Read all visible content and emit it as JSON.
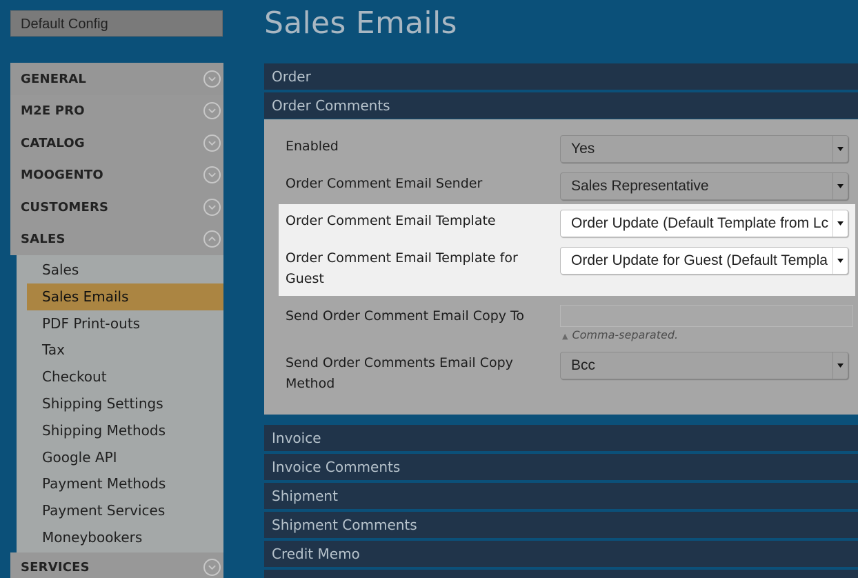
{
  "scope": {
    "label": "Default Config"
  },
  "sidebar": {
    "groups_top": [
      {
        "label": "GENERAL",
        "icon": "chevron-down-icon"
      },
      {
        "label": "M2E PRO",
        "icon": "chevron-down-icon"
      },
      {
        "label": "CATALOG",
        "icon": "chevron-down-icon"
      },
      {
        "label": "MOOGENTO",
        "icon": "chevron-down-icon"
      },
      {
        "label": "CUSTOMERS",
        "icon": "chevron-down-icon"
      },
      {
        "label": "SALES",
        "icon": "chevron-up-icon"
      }
    ],
    "sales_items": [
      {
        "label": "Sales"
      },
      {
        "label": "Sales Emails",
        "active": true
      },
      {
        "label": "PDF Print-outs"
      },
      {
        "label": "Tax"
      },
      {
        "label": "Checkout"
      },
      {
        "label": "Shipping Settings"
      },
      {
        "label": "Shipping Methods"
      },
      {
        "label": "Google API"
      },
      {
        "label": "Payment Methods"
      },
      {
        "label": "Payment Services"
      },
      {
        "label": "Moneybookers"
      }
    ],
    "groups_bottom": [
      {
        "label": "SERVICES",
        "icon": "chevron-down-icon"
      }
    ]
  },
  "main": {
    "title": "Sales Emails",
    "sections": [
      {
        "label": "Order"
      },
      {
        "label": "Order Comments"
      },
      {
        "label": "Invoice"
      },
      {
        "label": "Invoice Comments"
      },
      {
        "label": "Shipment"
      },
      {
        "label": "Shipment Comments"
      },
      {
        "label": "Credit Memo"
      }
    ],
    "fields": {
      "enabled": {
        "label": "Enabled",
        "value": "Yes"
      },
      "sender": {
        "label": "Order Comment Email Sender",
        "value": "Sales Representative"
      },
      "template": {
        "label": "Order Comment Email Template",
        "value": "Order Update (Default Template from Lc"
      },
      "guest_template": {
        "label": "Order Comment Email Template for Guest",
        "value": "Order Update for Guest (Default Templa"
      },
      "copy_to": {
        "label": "Send Order Comment Email Copy To",
        "value": "",
        "hint": "Comma-separated."
      },
      "copy_method": {
        "label": "Send Order Comments Email Copy Method",
        "value": "Bcc"
      }
    }
  },
  "colors": {
    "background": "#0b5079",
    "section_header": "#20344a",
    "active_item": "#ab8542",
    "highlight": "#f0f0f0"
  }
}
